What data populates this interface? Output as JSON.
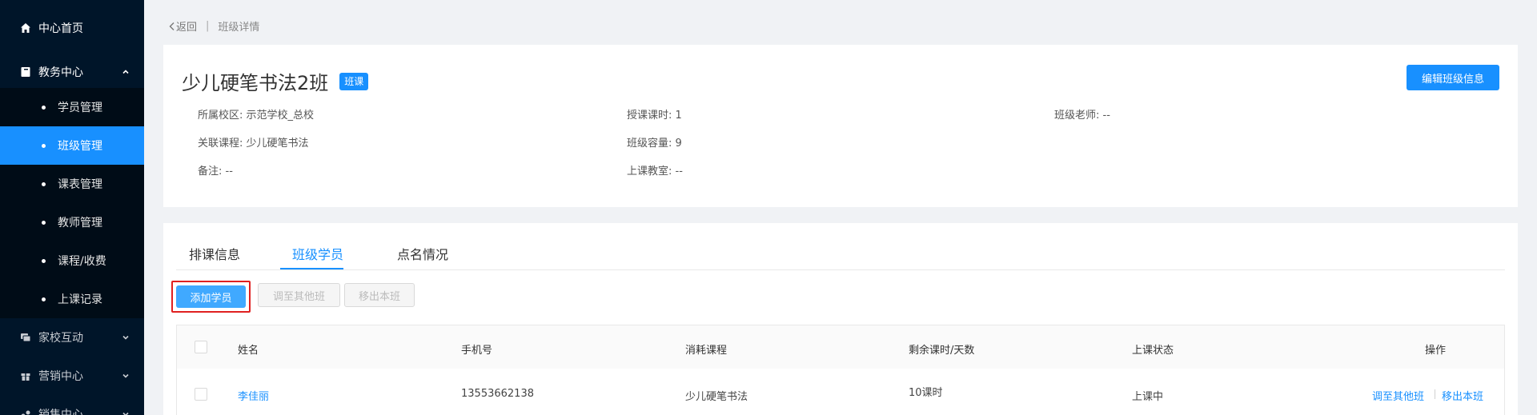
{
  "sidebar": {
    "home": "中心首页",
    "academic": "教务中心",
    "academic_items": [
      "学员管理",
      "班级管理",
      "课表管理",
      "教师管理",
      "课程/收费",
      "上课记录"
    ],
    "home_school": "家校互动",
    "marketing": "营销中心",
    "sales": "销售中心"
  },
  "breadcrumb": {
    "back": "返回",
    "current": "班级详情"
  },
  "class": {
    "name": "少儿硬笔书法2班",
    "tag": "班课",
    "edit_button": "编辑班级信息",
    "info": {
      "campus": "所属校区: 示范学校_总校",
      "course": "关联课程: 少儿硬笔书法",
      "remark": "备注: --",
      "hours": "授课课时: 1",
      "capacity": "班级容量: 9",
      "classroom": "上课教室: --",
      "teacher": "班级老师: --"
    }
  },
  "tabs": [
    "排课信息",
    "班级学员",
    "点名情况"
  ],
  "actions": {
    "add": "添加学员",
    "transfer": "调至其他班",
    "remove": "移出本班"
  },
  "table": {
    "headers": [
      "姓名",
      "手机号",
      "消耗课程",
      "剩余课时/天数",
      "上课状态",
      "操作"
    ],
    "rows": [
      {
        "name": "李佳丽",
        "phone": "13553662138",
        "course": "少儿硬笔书法",
        "remaining": "10课时",
        "status": "上课中",
        "op_transfer": "调至其他班",
        "op_remove": "移出本班"
      }
    ]
  },
  "colors": {
    "sidebar_bg": "#001529",
    "submenu_bg": "#000c17",
    "accent": "#1890ff",
    "highlight_border": "#e02020"
  }
}
